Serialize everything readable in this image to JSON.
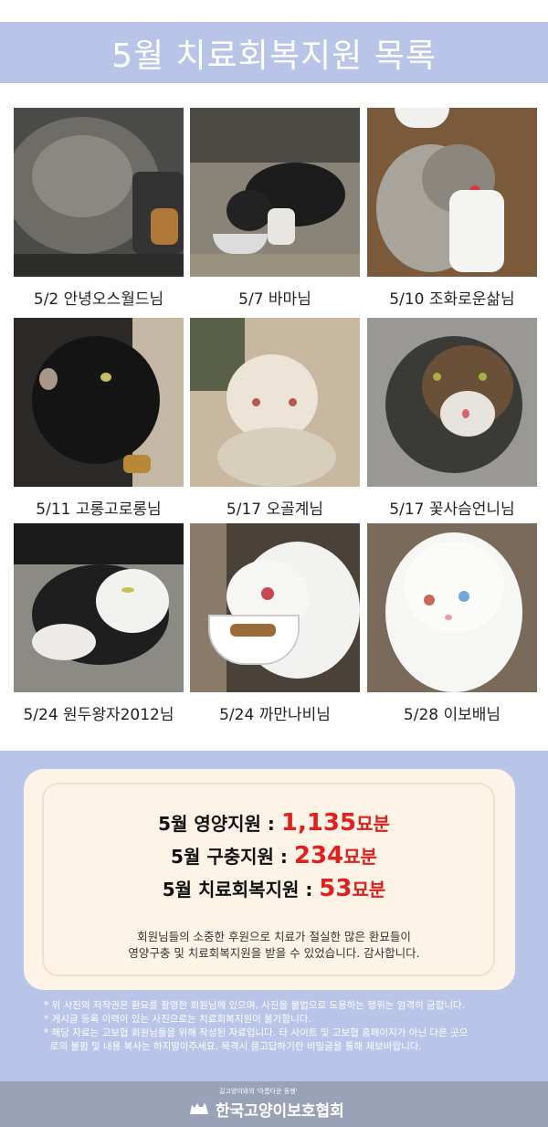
{
  "header": {
    "title": "5월 치료회복지원 목록"
  },
  "gallery": [
    {
      "caption": "5/2 안녕오스월드님"
    },
    {
      "caption": "5/7 바마님"
    },
    {
      "caption": "5/10 조화로운삶님"
    },
    {
      "caption": "5/11 고롱고로롱님"
    },
    {
      "caption": "5/17 오골계님"
    },
    {
      "caption": "5/17 꽃사슴언니님"
    },
    {
      "caption": "5/24 원두왕자2012님"
    },
    {
      "caption": "5/24 까만나비님"
    },
    {
      "caption": "5/28 이보배님"
    }
  ],
  "summary": {
    "nutrition": {
      "label": "5월 영양지원 :",
      "value": "1,135",
      "unit": "묘분"
    },
    "deworming": {
      "label": "5월 구충지원 :",
      "value": "234",
      "unit": "묘분"
    },
    "treatment": {
      "label": "5월 치료회복지원 :",
      "value": "53",
      "unit": "묘분"
    },
    "thanks_line1": "회원님들의 소중한 후원으로 치료가 절실한 많은 환묘들이",
    "thanks_line2": "영양구충 및 치료회복지원을 받을 수 있었습니다. 감사합니다."
  },
  "notes": [
    "* 위 사진의 저작권은 환묘를 촬영한 회원님께 있으며, 사진을 불법으로 도용하는 행위는 엄격히 금합니다.",
    "* 게시글 등록 이력이 있는 사진으로는 치료회복지원이 불가합니다.",
    "* 해당 자료는 고보협 회원님들을 위해 작성된 자료입니다. 타 사이트 및 고보협 홈페이지가 아닌 다른 곳으",
    "  로의 불펌 및 내용 복사는 하지말아주세요. 목격시 묻고답하기란 비밀글을 통해 제보바랍니다."
  ],
  "footer": {
    "tagline": "길고양이와의 '아름다운 동행'",
    "organization": "한국고양이보호협회"
  },
  "colors": {
    "accent": "#b8c4e8",
    "highlight": "#e0201c",
    "card": "#fdf3e6",
    "footer": "#9aa2b8"
  }
}
